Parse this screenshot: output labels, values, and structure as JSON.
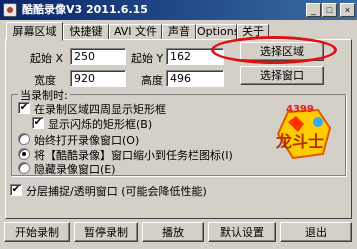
{
  "window": {
    "title": "酷酷录像V3 2011.6.15",
    "minimize_icon": "minimize-icon",
    "maximize_icon": "maximize-icon",
    "close_icon": "close-icon"
  },
  "tabs": [
    {
      "label": "屏幕区域",
      "active": true
    },
    {
      "label": "快捷键",
      "active": false
    },
    {
      "label": "AVI 文件",
      "active": false
    },
    {
      "label": "声音",
      "active": false
    },
    {
      "label": "Options",
      "active": false
    },
    {
      "label": "关于",
      "active": false
    }
  ],
  "region": {
    "start_x_label": "起始 X",
    "start_x_value": "250",
    "start_y_label": "起始 Y",
    "start_y_value": "162",
    "width_label": "宽度",
    "width_value": "920",
    "height_label": "高度",
    "height_value": "496",
    "select_region_button": "选择区域",
    "select_window_button": "选择窗口",
    "highlight_color": "#e01010"
  },
  "recording": {
    "group_label": "当录制时:",
    "show_rect_label": "在录制区域四周显示矩形框",
    "show_rect_checked": true,
    "blink_rect_label": "显示闪烁的矩形框(B)",
    "blink_rect_checked": true,
    "always_on_top_label": "始终打开录像窗口(O)",
    "minimize_to_tray_label": "将【酷酷录像】窗口缩小到任务栏图标(I)",
    "hide_window_label": "隐藏录像窗口(E)",
    "selected_option": 1
  },
  "layered": {
    "label": "分层捕捉/透明窗口 (可能会降低性能)",
    "checked": true
  },
  "logo": {
    "number": "4399",
    "text": "龙斗士",
    "icon": "game-logo-icon"
  },
  "bottom": {
    "start_button": "开始录制",
    "pause_button": "暂停录制",
    "play_button": "播放",
    "default_button": "默认设置",
    "exit_button": "退出"
  },
  "colors": {
    "titlebar_start": "#0a246a",
    "titlebar_end": "#3a6ea5",
    "face": "#d4d0c8"
  }
}
